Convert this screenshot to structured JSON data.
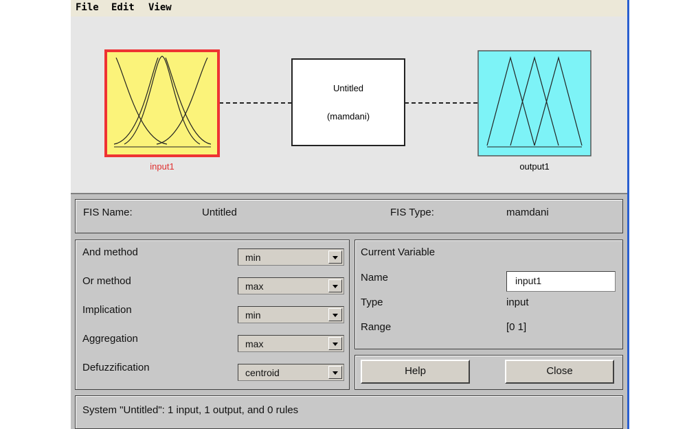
{
  "menu": {
    "file": "File",
    "edit": "Edit",
    "view": "View"
  },
  "diagram": {
    "input_label": "input1",
    "system_name": "Untitled",
    "system_type": "(mamdani)",
    "output_label": "output1"
  },
  "fis": {
    "name_label": "FIS Name:",
    "name_value": "Untitled",
    "type_label": "FIS Type:",
    "type_value": "mamdani"
  },
  "methods": {
    "and_label": "And method",
    "and_value": "min",
    "or_label": "Or method",
    "or_value": "max",
    "implication_label": "Implication",
    "implication_value": "min",
    "aggregation_label": "Aggregation",
    "aggregation_value": "max",
    "defuzz_label": "Defuzzification",
    "defuzz_value": "centroid"
  },
  "current_variable": {
    "title": "Current Variable",
    "name_label": "Name",
    "name_value": "input1",
    "type_label": "Type",
    "type_value": "input",
    "range_label": "Range",
    "range_value": "[0 1]"
  },
  "buttons": {
    "help": "Help",
    "close": "Close"
  },
  "status": "System \"Untitled\": 1 input, 1 output, and 0 rules",
  "colors": {
    "input_fill": "#fbf37a",
    "input_border": "#ee3333",
    "output_fill": "#7df3f7",
    "selected_label": "#e03030"
  }
}
